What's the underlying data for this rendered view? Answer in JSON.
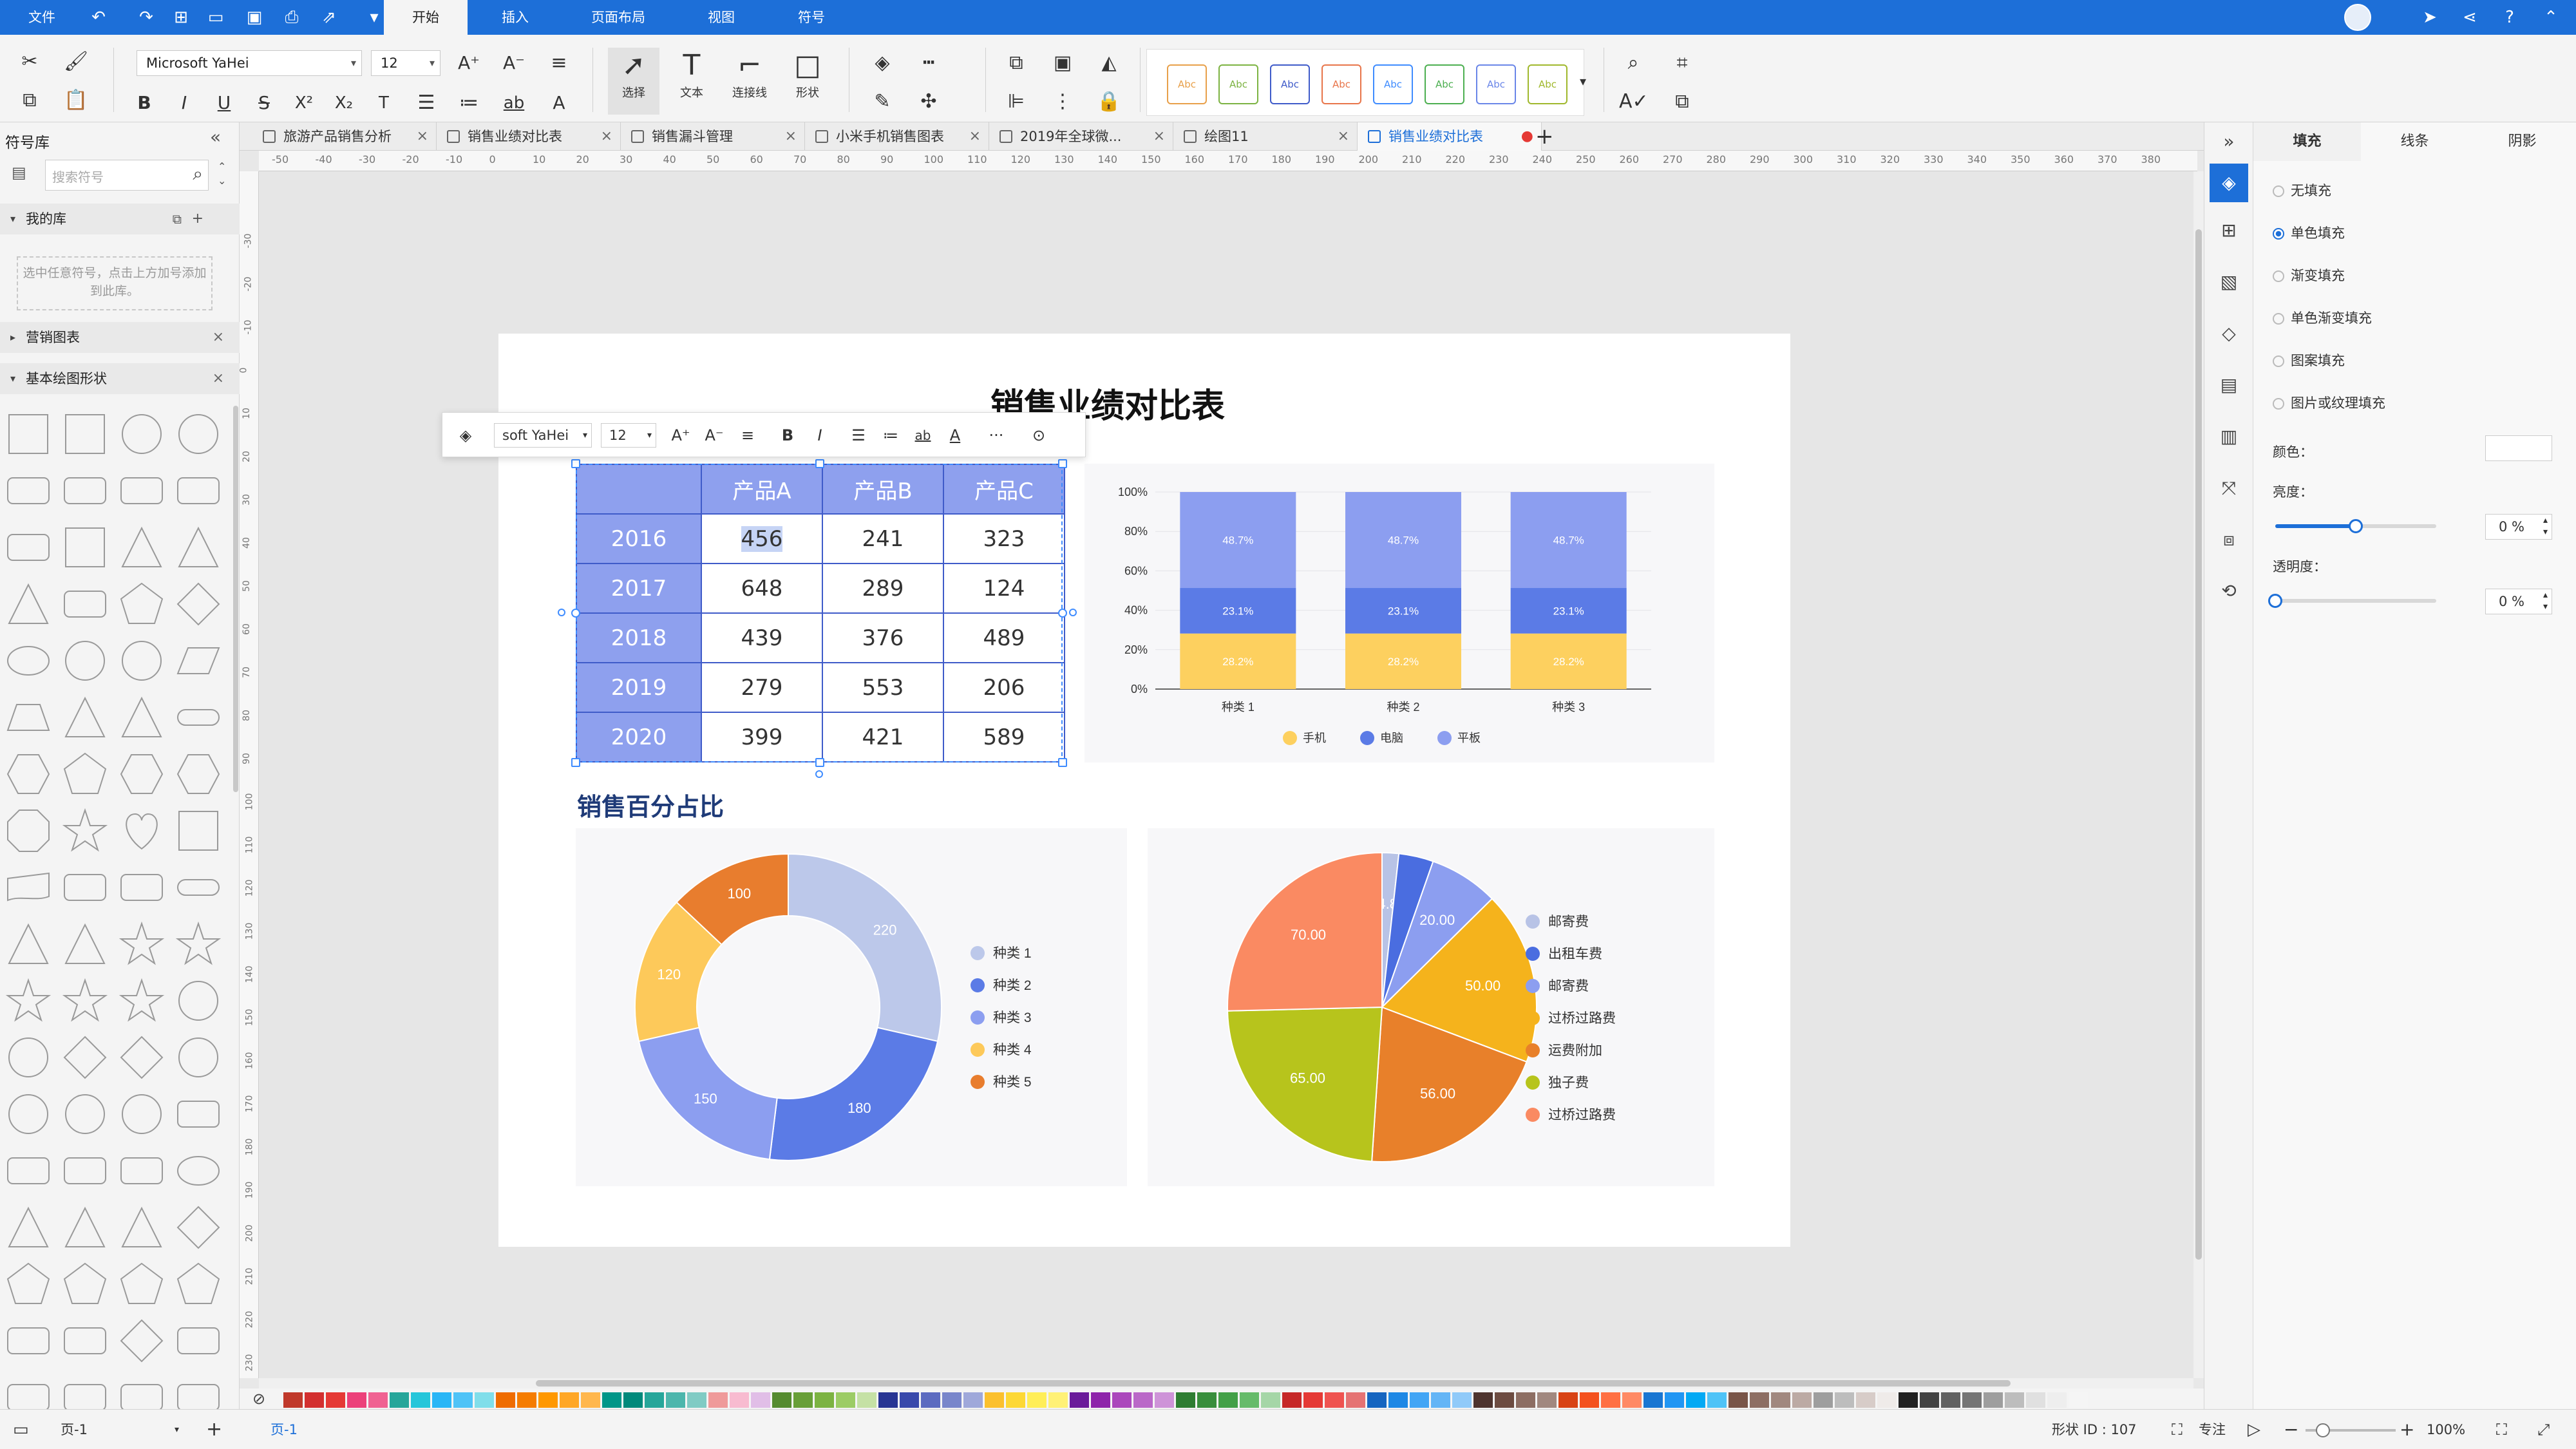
{
  "menu": {
    "file": "文件",
    "tabs": [
      "开始",
      "插入",
      "页面布局",
      "视图",
      "符号"
    ]
  },
  "ribbon": {
    "font_name": "Microsoft YaHei",
    "font_size": "12",
    "tools": {
      "select": "选择",
      "text": "文本",
      "connector": "连接线",
      "shape": "形状"
    },
    "style_preset": "Abc",
    "style_colors": [
      "#e8a04a",
      "#7cb342",
      "#3f5bc9",
      "#e8754a",
      "#3f8cff",
      "#4caf50",
      "#6a86e8",
      "#a0b82c"
    ]
  },
  "left_panel": {
    "title": "符号库",
    "search_placeholder": "搜索符号",
    "my_library": "我的库",
    "drop_hint": "选中任意符号，点击上方加号添加到此库。",
    "marketing_charts": "营销图表",
    "basic_shapes": "基本绘图形状"
  },
  "doc_tabs": [
    "旅游产品销售分析",
    "销售业绩对比表",
    "销售漏斗管理",
    "小米手机销售图表",
    "2019年全球微...",
    "绘图11",
    "销售业绩对比表"
  ],
  "page": {
    "title": "销售业绩对比表",
    "subtitle": "销售百分占比",
    "table": {
      "headers": [
        "",
        "产品A",
        "产品B",
        "产品C"
      ],
      "rows": [
        [
          "2016",
          "456",
          "241",
          "323"
        ],
        [
          "2017",
          "648",
          "289",
          "124"
        ],
        [
          "2018",
          "439",
          "376",
          "489"
        ],
        [
          "2019",
          "279",
          "553",
          "206"
        ],
        [
          "2020",
          "399",
          "421",
          "589"
        ]
      ]
    }
  },
  "float_toolbar": {
    "font": "soft YaHei",
    "size": "12"
  },
  "chart_data": [
    {
      "type": "bar",
      "stacked": true,
      "categories": [
        "种类 1",
        "种类 2",
        "种类 3"
      ],
      "series": [
        {
          "name": "手机",
          "values": [
            28.2,
            28.2,
            28.2
          ],
          "color": "#fdd05f"
        },
        {
          "name": "电脑",
          "values": [
            23.1,
            23.1,
            23.1
          ],
          "color": "#5b7be6"
        },
        {
          "name": "平板",
          "values": [
            48.7,
            48.7,
            48.7
          ],
          "color": "#8c9ef0"
        }
      ],
      "y_ticks": [
        "0%",
        "20%",
        "40%",
        "60%",
        "80%",
        "100%"
      ],
      "ylim": [
        0,
        100
      ],
      "legend": "bottom"
    },
    {
      "type": "pie",
      "donut": true,
      "labels": [
        "种类 1",
        "种类 2",
        "种类 3",
        "种类 4",
        "种类 5"
      ],
      "values": [
        220,
        180,
        150,
        120,
        100
      ],
      "colors": [
        "#bcc8ea",
        "#5b7be6",
        "#8c9ef0",
        "#fdc95a",
        "#e87d2e"
      ],
      "legend": "right"
    },
    {
      "type": "pie",
      "labels": [
        "邮寄费",
        "出租车费",
        "邮寄费",
        "过桥过路费",
        "运费附加",
        "独子费",
        "过桥过路费"
      ],
      "values": [
        4.8,
        10.0,
        20.0,
        50.0,
        56.0,
        65.0,
        70.0
      ],
      "value_labels": [
        "4.8",
        "",
        "20.00",
        "50.00",
        "56.00",
        "65.00",
        "70.00"
      ],
      "colors": [
        "#b8c3e6",
        "#4a6de0",
        "#8c9ef0",
        "#f5b31c",
        "#e8802a",
        "#b7c41c",
        "#fa8a62"
      ],
      "legend": "right"
    }
  ],
  "right_panel": {
    "tabs": [
      "填充",
      "线条",
      "阴影"
    ],
    "options": [
      "无填充",
      "单色填充",
      "渐变填充",
      "单色渐变填充",
      "图案填充",
      "图片或纹理填充"
    ],
    "selected_option": "单色填充",
    "color_label": "颜色：",
    "brightness_label": "亮度：",
    "brightness_value": "0 %",
    "brightness_level": 0.5,
    "opacity_label": "透明度：",
    "opacity_value": "0 %",
    "opacity_level": 0
  },
  "status": {
    "page_select": "页-1",
    "page_tab": "页-1",
    "shape_id": "形状 ID : 107",
    "focus": "专注",
    "zoom": "100%"
  }
}
